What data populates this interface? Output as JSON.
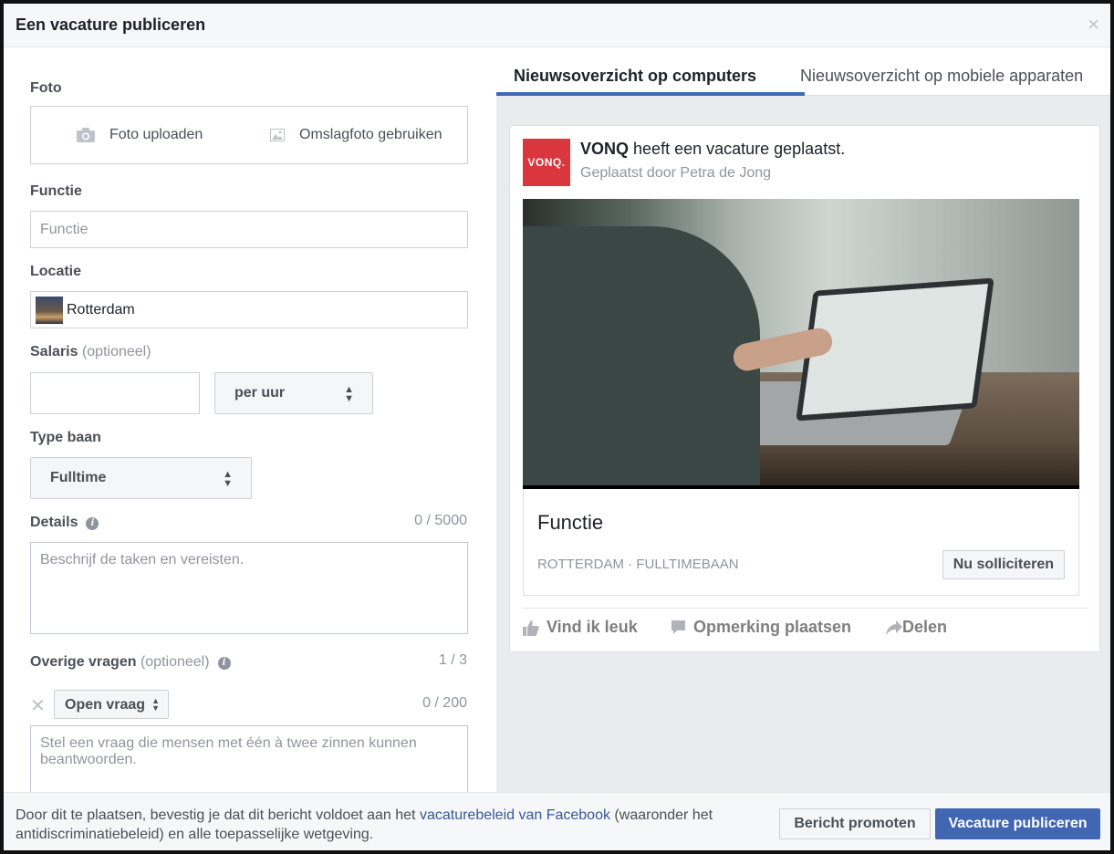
{
  "dialog": {
    "title": "Een vacature publiceren",
    "close": "×"
  },
  "form": {
    "photo": {
      "label": "Foto",
      "upload": "Foto uploaden",
      "cover": "Omslagfoto gebruiken"
    },
    "function": {
      "label": "Functie",
      "placeholder": "Functie"
    },
    "location": {
      "label": "Locatie",
      "value": "Rotterdam"
    },
    "salary": {
      "label": "Salaris",
      "optional": "(optioneel)",
      "value": "",
      "period": "per uur"
    },
    "job_type": {
      "label": "Type baan",
      "value": "Fulltime"
    },
    "details": {
      "label": "Details",
      "count": "0 / 5000",
      "placeholder": "Beschrijf de taken en vereisten."
    },
    "other": {
      "label": "Overige vragen",
      "optional": "(optioneel)",
      "count": "1 / 3",
      "question_type": "Open vraag",
      "question_count": "0 / 200",
      "question_placeholder": "Stel een vraag die mensen met één à twee zinnen kunnen beantwoorden."
    }
  },
  "preview": {
    "tabs": [
      "Nieuwsoverzicht op computers",
      "Nieuwsoverzicht op mobiele apparaten"
    ],
    "logo_text": "VONQ.",
    "company": "VONQ",
    "posted_text": "heeft een vacature geplaatst.",
    "byline": "Geplaatst door Petra de Jong",
    "job_title": "Functie",
    "meta": "ROTTERDAM · FULLTIMEBAAN",
    "apply": "Nu solliciteren",
    "actions": {
      "like": "Vind ik leuk",
      "comment": "Opmerking plaatsen",
      "share": "Delen"
    }
  },
  "footer": {
    "note_before": "Door dit te plaatsen, bevestig je dat dit bericht voldoet aan het ",
    "note_link": "vacaturebeleid van Facebook",
    "note_after": " (waaronder het antidiscriminatiebeleid) en alle toepasselijke wetgeving.",
    "promote": "Bericht promoten",
    "publish": "Vacature publiceren"
  },
  "colors": {
    "primary": "#4267b2",
    "link": "#365899",
    "logo_bg": "#d9363e"
  }
}
